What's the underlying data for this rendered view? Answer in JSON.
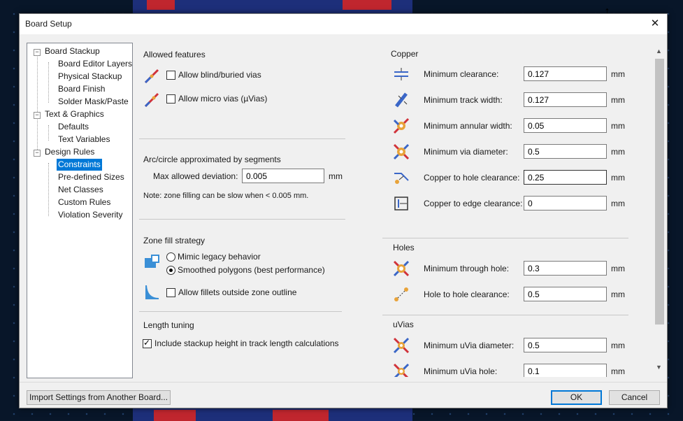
{
  "window": {
    "title": "Board Setup",
    "close_glyph": "✕"
  },
  "tree": {
    "items": [
      {
        "label": "Board Stackup"
      },
      {
        "label": "Board Editor Layers"
      },
      {
        "label": "Physical Stackup"
      },
      {
        "label": "Board Finish"
      },
      {
        "label": "Solder Mask/Paste"
      },
      {
        "label": "Text & Graphics"
      },
      {
        "label": "Defaults"
      },
      {
        "label": "Text Variables"
      },
      {
        "label": "Design Rules"
      },
      {
        "label": "Constraints"
      },
      {
        "label": "Pre-defined Sizes"
      },
      {
        "label": "Net Classes"
      },
      {
        "label": "Custom Rules"
      },
      {
        "label": "Violation Severity"
      }
    ],
    "selected": "Constraints"
  },
  "allowed": {
    "title": "Allowed features",
    "blind_label": "Allow blind/buried vias",
    "micro_label": "Allow micro vias (µVias)",
    "blind_checked": false,
    "micro_checked": false
  },
  "arc": {
    "title": "Arc/circle approximated by segments",
    "deviation_label": "Max allowed deviation:",
    "deviation_value": "0.005",
    "deviation_unit": "mm",
    "note": "Note: zone filling can be slow when < 0.005 mm."
  },
  "zone": {
    "title": "Zone fill strategy",
    "legacy_label": "Mimic legacy behavior",
    "smoothed_label": "Smoothed polygons (best performance)",
    "selected": "smoothed",
    "fillets_label": "Allow fillets outside zone outline",
    "fillets_checked": false
  },
  "length": {
    "title": "Length tuning",
    "stackup_label": "Include stackup height in track length calculations",
    "stackup_checked": true
  },
  "copper": {
    "title": "Copper",
    "rows": [
      {
        "label": "Minimum clearance:",
        "value": "0.127",
        "unit": "mm",
        "icon": "clearance-icon"
      },
      {
        "label": "Minimum track width:",
        "value": "0.127",
        "unit": "mm",
        "icon": "track-width-icon"
      },
      {
        "label": "Minimum annular width:",
        "value": "0.05",
        "unit": "mm",
        "icon": "annular-width-icon"
      },
      {
        "label": "Minimum via diameter:",
        "value": "0.5",
        "unit": "mm",
        "icon": "via-diameter-icon"
      },
      {
        "label": "Copper to hole clearance:",
        "value": "0.25",
        "unit": "mm",
        "icon": "hole-clearance-icon"
      },
      {
        "label": "Copper to edge clearance:",
        "value": "0",
        "unit": "mm",
        "icon": "edge-clearance-icon"
      }
    ]
  },
  "holes": {
    "title": "Holes",
    "rows": [
      {
        "label": "Minimum through hole:",
        "value": "0.3",
        "unit": "mm",
        "icon": "through-hole-icon"
      },
      {
        "label": "Hole to hole clearance:",
        "value": "0.5",
        "unit": "mm",
        "icon": "hole-to-hole-icon"
      }
    ]
  },
  "uvias": {
    "title": "uVias",
    "rows": [
      {
        "label": "Minimum uVia diameter:",
        "value": "0.5",
        "unit": "mm",
        "icon": "uvia-diameter-icon"
      },
      {
        "label": "Minimum uVia hole:",
        "value": "0.1",
        "unit": "mm",
        "icon": "uvia-hole-icon"
      }
    ]
  },
  "buttons": {
    "import_label": "Import Settings from Another Board...",
    "ok_label": "OK",
    "cancel_label": "Cancel"
  },
  "colors": {
    "selection": "#0078d7",
    "via_orange": "#e8a33a",
    "track_blue": "#3a66c7",
    "track_red": "#d0323a"
  }
}
